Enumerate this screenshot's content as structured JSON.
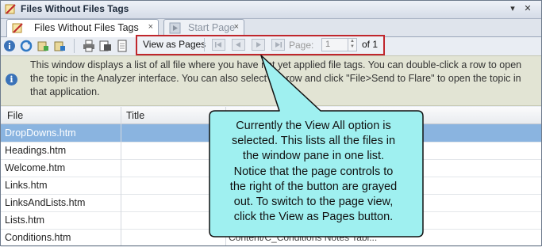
{
  "window": {
    "title": "Files Without Files Tags"
  },
  "tabs": [
    {
      "label": "Files Without Files Tags",
      "close": "×"
    },
    {
      "label": "Start Page",
      "close": "×"
    }
  ],
  "pagebar": {
    "view_button": "View as Pages",
    "page_label": "Page:",
    "page_value": "1",
    "of_label": "of 1"
  },
  "info": {
    "text": "This window displays a list of all file where you have not yet applied file tags. You can double-click a row to open the topic in the Analyzer interface. You can also select the row and click \"File>Send to Flare\" to open the topic in that application."
  },
  "grid": {
    "columns": [
      "File",
      "Title",
      ""
    ],
    "rows": [
      {
        "file": "DropDowns.htm",
        "path": ""
      },
      {
        "file": "Headings.htm",
        "path": ""
      },
      {
        "file": "Welcome.htm",
        "path": ""
      },
      {
        "file": "Links.htm",
        "path": ""
      },
      {
        "file": "LinksAndLists.htm",
        "path": ""
      },
      {
        "file": "Lists.htm",
        "path": ""
      },
      {
        "file": "Conditions.htm",
        "path": "Content/C_Conditions Notes Tabl..."
      }
    ]
  },
  "callout": {
    "lines": [
      "Currently the View All option is",
      "selected. This lists all the files in",
      "the window pane in one list.",
      "Notice that the page controls to",
      "the right of the button are grayed",
      "out. To switch to the page view,",
      "click the View as Pages button."
    ]
  },
  "colors": {
    "selection": "#8ab4e0",
    "callout_fill": "#9ff0f0",
    "highlight_border": "#c0262c",
    "info_bg": "#e2e4d4"
  }
}
